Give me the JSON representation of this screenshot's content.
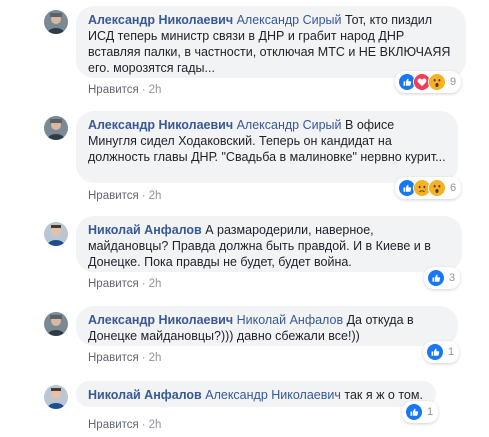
{
  "colors": {
    "link": "#385898",
    "bubble_bg": "#f2f3f5",
    "like_blue": "#1877f2",
    "love_red": "#f33e58",
    "emoji_yellow": "#f7b125"
  },
  "comments": [
    {
      "author": "Александр Николаевич",
      "mention": "Александр Сирый",
      "text": " Тот, кто пиздил ИСД теперь министр связи в ДНР и грабит народ ДНР вставляя палки, в частности, отключая МТС и НЕ ВКЛЮЧАЯЯ его. морозятся гады...",
      "like_label": "Нравится",
      "time": "2h",
      "reaction_icons": [
        "like-icon",
        "love-icon",
        "wow-icon"
      ],
      "reaction_count": "9"
    },
    {
      "author": "Александр Николаевич",
      "mention": "Александр Сирый",
      "text": " В офисе Минугля сидел Ходаковский. Теперь он кандидат на должность главы ДНР. \"Свадьба в малиновке\" нервно курит...",
      "like_label": "Нравится",
      "time": "2h",
      "reaction_icons": [
        "like-icon",
        "sad-icon",
        "wow-icon"
      ],
      "reaction_count": "6"
    },
    {
      "author": "Николай Анфалов",
      "mention": "",
      "text": " А размародерили, наверное, майдановцы? Правда должна быть правдой. И в Киеве и в Донецке. Пока правды не будет, будет война.",
      "like_label": "Нравится",
      "time": "2h",
      "reaction_icons": [
        "like-icon"
      ],
      "reaction_count": "3"
    },
    {
      "author": "Александр Николаевич",
      "mention": "Николай Анфалов",
      "text": " Да откуда в Донецке майдановцы?))) давно сбежали все!))",
      "like_label": "Нравится",
      "time": "2h",
      "reaction_icons": [
        "like-icon"
      ],
      "reaction_count": "1"
    },
    {
      "author": "Николай Анфалов",
      "mention": "Александр Николаевич",
      "text": " так я ж о том.",
      "like_label": "Нравится",
      "time": "2h",
      "reaction_icons": [
        "like-icon"
      ],
      "reaction_count": "1"
    }
  ]
}
